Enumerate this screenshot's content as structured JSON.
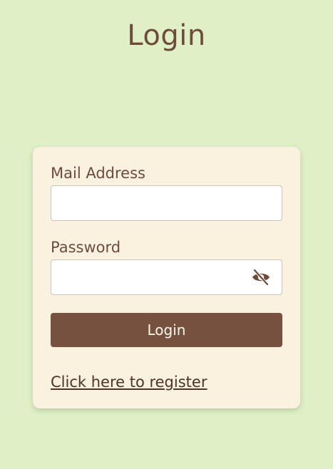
{
  "page": {
    "title": "Login"
  },
  "form": {
    "email_label": "Mail Address",
    "email_value": "",
    "email_placeholder": "",
    "password_label": "Password",
    "password_value": "",
    "password_placeholder": "",
    "password_toggle_icon": "eye-slash-icon",
    "submit_label": "Login",
    "register_link": "Click here to register"
  },
  "colors": {
    "background": "#dff0c6",
    "card": "#faf1df",
    "accent": "#76513f",
    "text": "#6e4b3a"
  }
}
